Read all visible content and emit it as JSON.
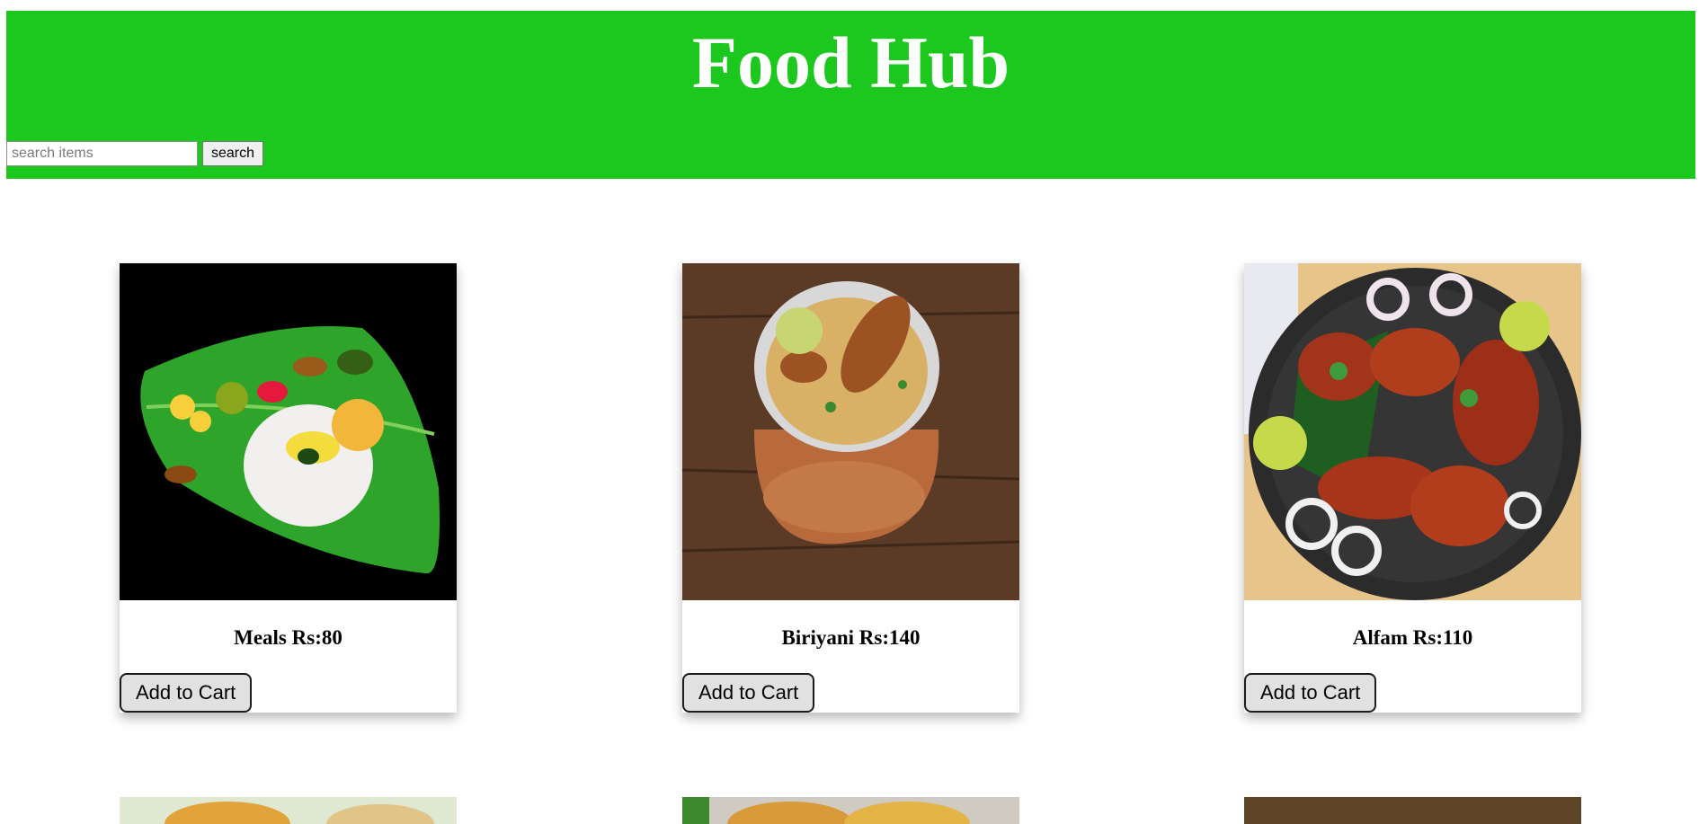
{
  "header": {
    "title": "Food Hub",
    "search_placeholder": "search items",
    "search_button": "search"
  },
  "items": [
    {
      "name": "Meals Rs:80",
      "button": "Add to Cart"
    },
    {
      "name": "Biriyani Rs:140",
      "button": "Add to Cart"
    },
    {
      "name": "Alfam Rs:110",
      "button": "Add to Cart"
    }
  ],
  "colors": {
    "header_bg": "#1cc81e",
    "title": "#ffffff",
    "button_bg": "#e1e1e1"
  }
}
